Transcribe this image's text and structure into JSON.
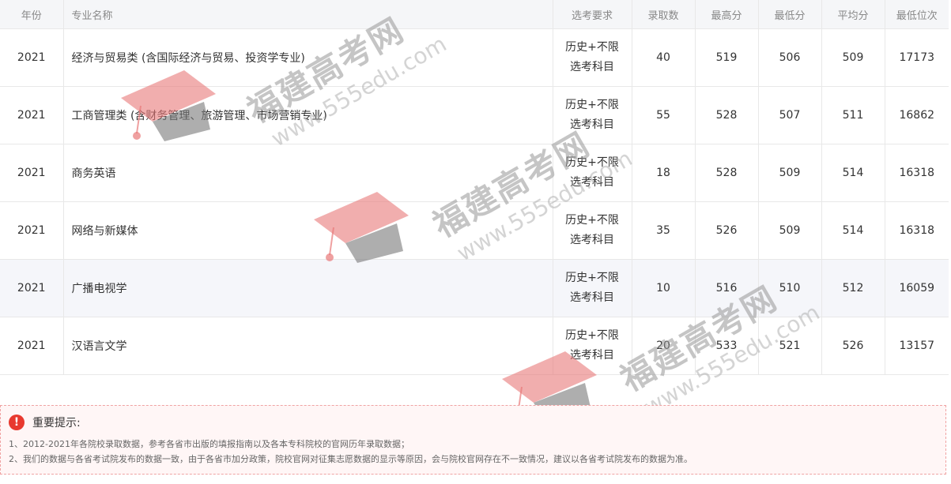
{
  "table": {
    "headers": {
      "year": "年份",
      "major": "专业名称",
      "requirement": "选考要求",
      "admitted": "录取数",
      "max_score": "最高分",
      "min_score": "最低分",
      "avg_score": "平均分",
      "min_rank": "最低位次"
    },
    "rows": [
      {
        "year": "2021",
        "major": "经济与贸易类 (含国际经济与贸易、投资学专业)",
        "req1": "历史+不限",
        "req2": "选考科目",
        "admitted": "40",
        "max": "519",
        "min": "506",
        "avg": "509",
        "rank": "17173"
      },
      {
        "year": "2021",
        "major": "工商管理类 (含财务管理、旅游管理、市场营销专业)",
        "req1": "历史+不限",
        "req2": "选考科目",
        "admitted": "55",
        "max": "528",
        "min": "507",
        "avg": "511",
        "rank": "16862"
      },
      {
        "year": "2021",
        "major": "商务英语",
        "req1": "历史+不限",
        "req2": "选考科目",
        "admitted": "18",
        "max": "528",
        "min": "509",
        "avg": "514",
        "rank": "16318"
      },
      {
        "year": "2021",
        "major": "网络与新媒体",
        "req1": "历史+不限",
        "req2": "选考科目",
        "admitted": "35",
        "max": "526",
        "min": "509",
        "avg": "514",
        "rank": "16318"
      },
      {
        "year": "2021",
        "major": "广播电视学",
        "req1": "历史+不限",
        "req2": "选考科目",
        "admitted": "10",
        "max": "516",
        "min": "510",
        "avg": "512",
        "rank": "16059"
      },
      {
        "year": "2021",
        "major": "汉语言文学",
        "req1": "历史+不限",
        "req2": "选考科目",
        "admitted": "20",
        "max": "533",
        "min": "521",
        "avg": "526",
        "rank": "13157"
      }
    ]
  },
  "notice": {
    "icon": "exclamation-icon",
    "title": "重要提示:",
    "line1": "1、2012-2021年各院校录取数据，参考各省市出版的填报指南以及各本专科院校的官网历年录取数据；",
    "line2": "2、我们的数据与各省考试院发布的数据一致，由于各省市加分政策，院校官网对征集志愿数据的显示等原因，会与院校官网存在不一致情况，建议以各省考试院发布的数据为准。"
  },
  "watermark": {
    "brand": "福建高考网",
    "url": "www.555edu.com"
  },
  "colors": {
    "header_bg": "#f5f6f8",
    "highlight_row_bg": "#f5f6fa",
    "notice_border": "#f0a3a3",
    "warning_red": "#e8392f"
  }
}
